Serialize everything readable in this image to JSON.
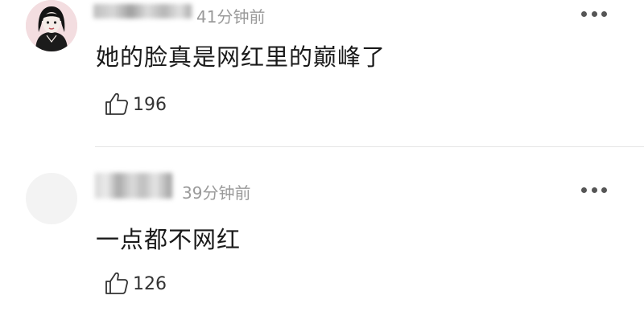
{
  "comments": [
    {
      "username": "j·····",
      "time": "41分钟前",
      "content": "她的脸真是网红里的巅峰了",
      "likes": "196",
      "avatar_icon": "female-portrait-avatar",
      "more_icon": "more-dots-icon",
      "like_icon": "thumbs-up-icon"
    },
    {
      "username": "▒▒▒▒",
      "time": "39分钟前",
      "content": "一点都不网红",
      "likes": "126",
      "avatar_icon": "blank-avatar",
      "more_icon": "more-dots-icon",
      "like_icon": "thumbs-up-icon"
    }
  ],
  "colors": {
    "meta_gray": "#9a9a9a",
    "text": "#1a1a1a",
    "divider": "#e6e6e6"
  }
}
